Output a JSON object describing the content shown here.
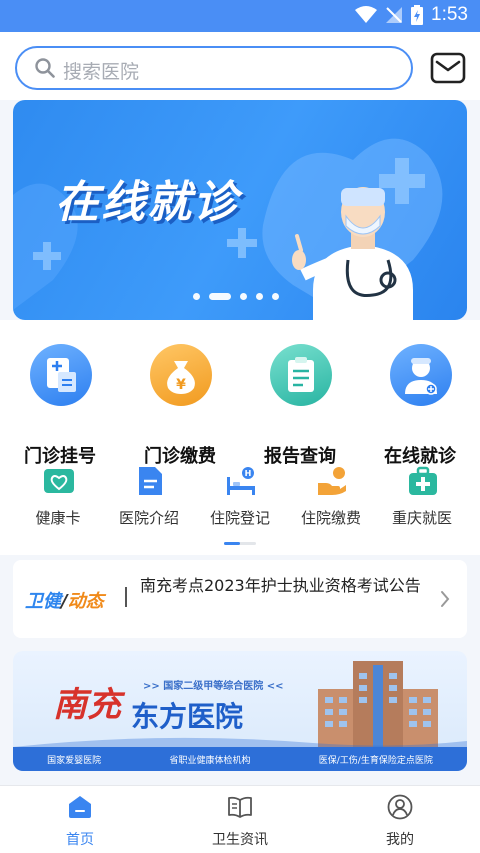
{
  "status_bar": {
    "time": "1:53"
  },
  "search": {
    "placeholder": "搜索医院"
  },
  "banner": {
    "title": "在线就诊"
  },
  "main_services": [
    {
      "label": "门诊挂号",
      "icon": "registration-icon"
    },
    {
      "label": "门诊缴费",
      "icon": "money-bag-icon"
    },
    {
      "label": "报告查询",
      "icon": "report-clipboard-icon"
    },
    {
      "label": "在线就诊",
      "icon": "doctor-icon"
    }
  ],
  "sub_services": [
    {
      "label": "健康卡",
      "icon": "health-card-icon"
    },
    {
      "label": "医院介绍",
      "icon": "document-icon"
    },
    {
      "label": "住院登记",
      "icon": "hospital-bed-icon"
    },
    {
      "label": "住院缴费",
      "icon": "payment-hand-icon"
    },
    {
      "label": "重庆就医",
      "icon": "medical-kit-icon"
    }
  ],
  "news": {
    "tag_part1": "卫健",
    "tag_slash": "/",
    "tag_part2": "动态",
    "text": "南充考点2023年护士执业资格考试公告"
  },
  "ad": {
    "top_line": ">> 国家二级甲等综合医院 <<",
    "name_part1": "南充",
    "name_part2": "东方医院",
    "features": [
      "国家爱婴医院",
      "省职业健康体检机构",
      "医保/工伤/生育保险定点医院"
    ]
  },
  "tabbar": {
    "home": "首页",
    "news": "卫生资讯",
    "mine": "我的"
  },
  "colors": {
    "accent": "#3a85f0",
    "status_bar": "#4a8ef5"
  }
}
